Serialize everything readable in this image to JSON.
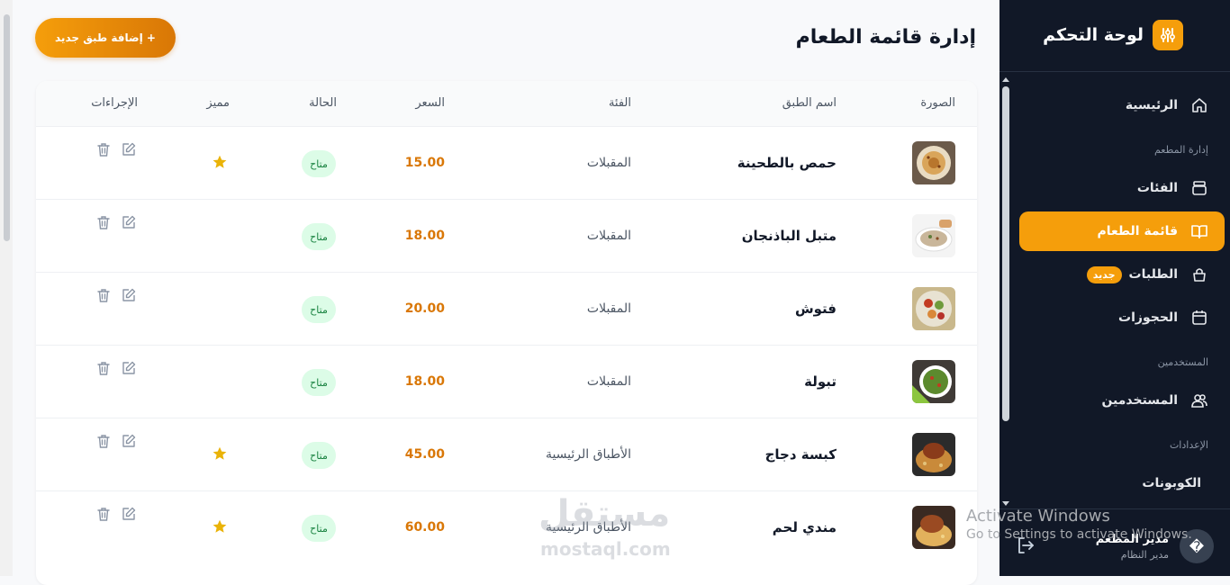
{
  "sidebar": {
    "title": "لوحة التحكم",
    "items": [
      {
        "label": "الرئيسية",
        "icon": "home-icon"
      },
      {
        "label": "الفئات",
        "icon": "layers-icon"
      },
      {
        "label": "قائمة الطعام",
        "icon": "book-icon",
        "active": true
      },
      {
        "label": "الطلبات",
        "icon": "bag-icon",
        "badge": "جديد"
      },
      {
        "label": "الحجوزات",
        "icon": "calendar-icon"
      },
      {
        "label": "المستخدمين",
        "icon": "users-icon"
      },
      {
        "label": "الكوبونات",
        "icon": ""
      }
    ],
    "sections": [
      "إدارة المطعم",
      "المستخدمين",
      "الإعدادات"
    ],
    "user": {
      "name": "مدير المطعم",
      "role": "مدير النظام",
      "avatar_glyph": "�"
    }
  },
  "header": {
    "title": "إدارة قائمة الطعام",
    "add_button": "+ إضافة طبق جديد"
  },
  "table": {
    "columns": [
      "الصورة",
      "اسم الطبق",
      "الفئة",
      "السعر",
      "الحالة",
      "مميز",
      "الإجراءات"
    ],
    "rows": [
      {
        "name": "حمص بالطحينة",
        "category": "المقبلات",
        "price": "15.00",
        "status": "متاح",
        "featured": true,
        "image": "hummus"
      },
      {
        "name": "متبل الباذنجان",
        "category": "المقبلات",
        "price": "18.00",
        "status": "متاح",
        "featured": false,
        "image": "mutabal"
      },
      {
        "name": "فتوش",
        "category": "المقبلات",
        "price": "20.00",
        "status": "متاح",
        "featured": false,
        "image": "fattoush"
      },
      {
        "name": "تبولة",
        "category": "المقبلات",
        "price": "18.00",
        "status": "متاح",
        "featured": false,
        "image": "tabbouleh"
      },
      {
        "name": "كبسة دجاج",
        "category": "الأطباق الرئيسية",
        "price": "45.00",
        "status": "متاح",
        "featured": true,
        "image": "kabsa"
      },
      {
        "name": "مندي لحم",
        "category": "الأطباق الرئيسية",
        "price": "60.00",
        "status": "متاح",
        "featured": true,
        "image": "mandi"
      }
    ]
  },
  "overlay": {
    "watermark_ar": "مستقل",
    "watermark_en": "mostaql.com",
    "activate_title": "Activate Windows",
    "activate_sub": "Go to Settings to activate Windows."
  },
  "colors": {
    "accent": "#f59e0b",
    "sidebar_bg": "#111827",
    "price": "#d97706",
    "status_bg": "#dcfce7",
    "status_text": "#15803d"
  }
}
